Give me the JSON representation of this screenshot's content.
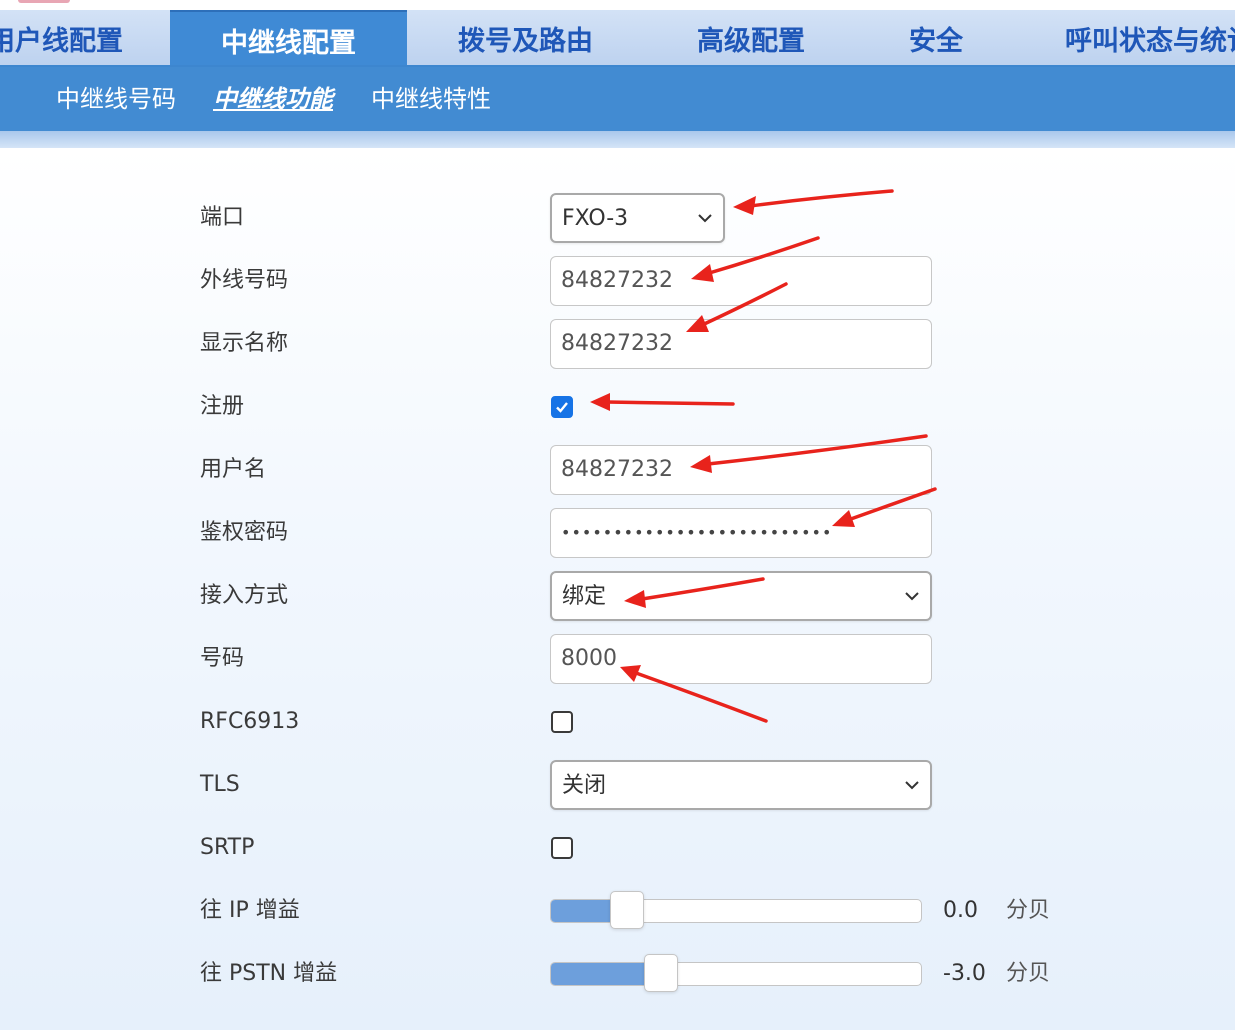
{
  "main_nav": {
    "tabs": [
      {
        "label": "用户线配置"
      },
      {
        "label": "中继线配置",
        "active": true
      },
      {
        "label": "拨号及路由"
      },
      {
        "label": "高级配置"
      },
      {
        "label": "安全"
      },
      {
        "label": "呼叫状态与统计"
      }
    ]
  },
  "sub_nav": {
    "tabs": [
      {
        "label": "中继线号码"
      },
      {
        "label": "中继线功能",
        "active": true
      },
      {
        "label": "中继线特性"
      }
    ]
  },
  "form": {
    "port": {
      "label": "端口",
      "value": "FXO-3"
    },
    "external_number": {
      "label": "外线号码",
      "value": "84827232"
    },
    "display_name": {
      "label": "显示名称",
      "value": "84827232"
    },
    "register": {
      "label": "注册",
      "checked": true
    },
    "username": {
      "label": "用户名",
      "value": "84827232"
    },
    "auth_password": {
      "label": "鉴权密码",
      "masked_value": "••••••••••••••••••••••••••"
    },
    "access_mode": {
      "label": "接入方式",
      "value": "绑定"
    },
    "number": {
      "label": "号码",
      "value": "8000"
    },
    "rfc6913": {
      "label": "RFC6913",
      "checked": false
    },
    "tls": {
      "label": "TLS",
      "value": "关闭"
    },
    "srtp": {
      "label": "SRTP",
      "checked": false
    },
    "gain_to_ip": {
      "label": "往 IP 增益",
      "value": "0.0",
      "unit": "分贝",
      "slider_fraction": 0.2
    },
    "gain_to_pstn": {
      "label": "往 PSTN 增益",
      "value": "-3.0",
      "unit": "分贝",
      "slider_fraction": 0.29
    }
  },
  "colors": {
    "annotation_arrow": "#e8231c",
    "nav_active": "#3f8ad5",
    "checkbox_checked": "#1673e6",
    "slider_fill": "#6d9fdc"
  }
}
